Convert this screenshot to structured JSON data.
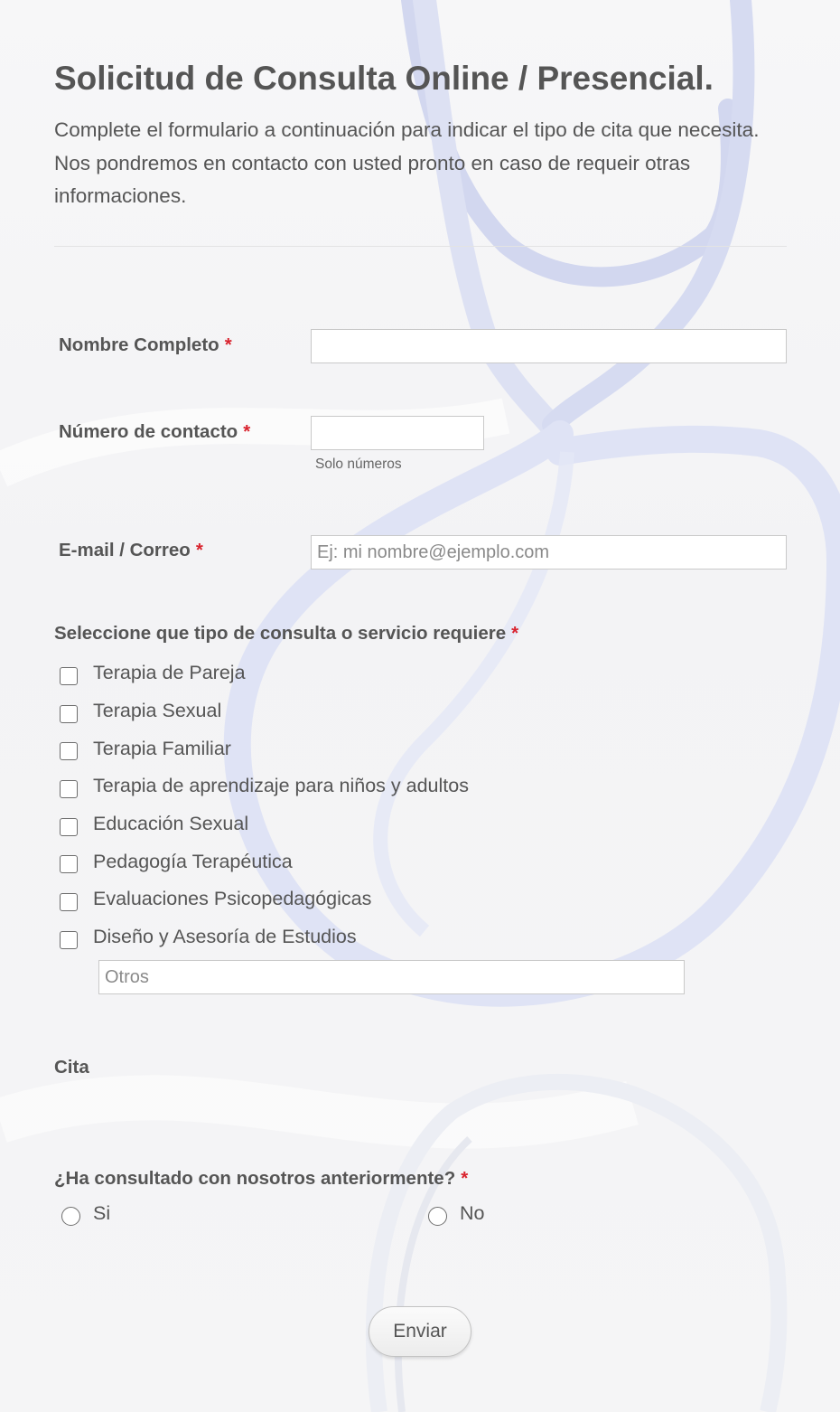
{
  "form": {
    "title": "Solicitud de Consulta Online / Presencial.",
    "description": "Complete el formulario a continuación para indicar el tipo de cita que necesita. Nos pondremos en contacto con usted pronto en caso de requeir otras informaciones.",
    "required_marker": "*",
    "accent_color": "#d9232e",
    "background_art": "stethoscope-watermark"
  },
  "fields": {
    "name": {
      "label": "Nombre Completo",
      "value": "",
      "placeholder": ""
    },
    "phone": {
      "label": "Número de contacto",
      "value": "",
      "placeholder": "",
      "sublabel": "Solo números"
    },
    "email": {
      "label": "E-mail / Correo",
      "value": "",
      "placeholder": "Ej: mi nombre@ejemplo.com"
    }
  },
  "services": {
    "label": "Seleccione que tipo de consulta o servicio requiere",
    "options": [
      {
        "label": "Terapia de Pareja",
        "checked": false
      },
      {
        "label": "Terapia Sexual",
        "checked": false
      },
      {
        "label": "Terapia Familiar",
        "checked": false
      },
      {
        "label": "Terapia de aprendizaje para niños y adultos",
        "checked": false
      },
      {
        "label": "Educación Sexual",
        "checked": false
      },
      {
        "label": "Pedagogía Terapéutica",
        "checked": false
      },
      {
        "label": "Evaluaciones Psicopedagógicas",
        "checked": false
      },
      {
        "label": "Diseño y Asesoría de Estudios",
        "checked": false
      }
    ],
    "other_placeholder": "Otros",
    "other_value": ""
  },
  "appointment": {
    "label": "Cita"
  },
  "previous": {
    "label": "¿Ha consultado con nosotros anteriormente?",
    "options": [
      {
        "label": "Si",
        "selected": false
      },
      {
        "label": "No",
        "selected": false
      }
    ]
  },
  "submit": {
    "label": "Enviar"
  }
}
